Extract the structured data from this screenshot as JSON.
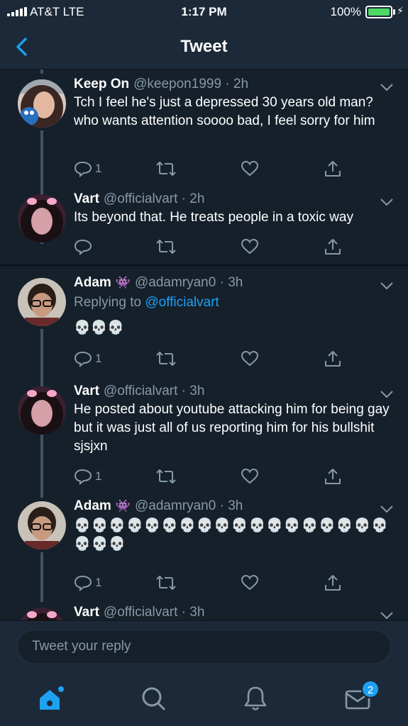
{
  "status_bar": {
    "carrier": "AT&T  LTE",
    "time": "1:17 PM",
    "battery": "100%",
    "battery_level": 1.0
  },
  "header": {
    "title": "Tweet"
  },
  "tweets": [
    {
      "name": "Keep On",
      "handle": "@keepon1999",
      "time": "2h",
      "text": "Tch I feel he's just a depressed 30 years old man?who wants attention soooo bad, I feel sorry for him",
      "reply_count": "1"
    },
    {
      "name": "Vart",
      "handle": "@officialvart",
      "time": "2h",
      "text": "Its beyond that. He treats people in a toxic way",
      "reply_count": ""
    },
    {
      "name": "Adam",
      "badge": "👾",
      "handle": "@adamryan0",
      "time": "3h",
      "replying_prefix": "Replying to",
      "replying_to": "@officialvart",
      "text": "💀💀💀",
      "reply_count": "1"
    },
    {
      "name": "Vart",
      "handle": "@officialvart",
      "time": "3h",
      "text": "He posted about youtube attacking him for being gay but it was just all of us reporting him for his bullshit sjsjxn",
      "reply_count": "1"
    },
    {
      "name": "Adam",
      "badge": "👾",
      "handle": "@adamryan0",
      "time": "3h",
      "text": "💀💀💀💀💀💀💀💀💀💀💀💀💀💀💀💀💀💀💀💀💀",
      "reply_count": "1"
    },
    {
      "name": "Vart",
      "handle": "@officialvart",
      "time": "3h"
    }
  ],
  "composer": {
    "placeholder": "Tweet your reply"
  },
  "tabbar": {
    "items": [
      "home-icon",
      "search-icon",
      "bell-icon",
      "mail-icon"
    ],
    "messages_badge": "2"
  },
  "colors": {
    "background": "#15202b",
    "bar": "#1c2938",
    "accent": "#1da1f2",
    "muted": "#8899a6"
  }
}
